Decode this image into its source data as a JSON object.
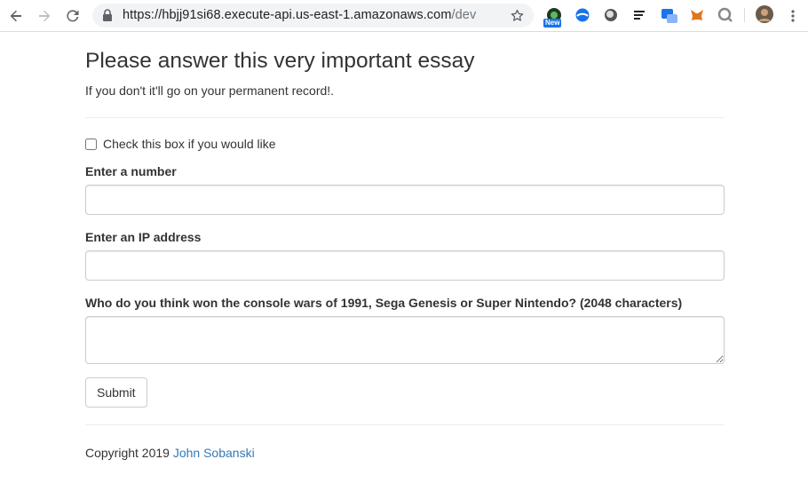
{
  "browser": {
    "url_host": "https://hbjj91si68.execute-api.us-east-1.amazonaws.com",
    "url_path": "/dev",
    "extension_badge": "New",
    "extension_icons": [
      "perfect-tree-icon",
      "ie-tab-icon",
      "circle-extension-icon",
      "notes-extension-icon",
      "translate-extension-icon",
      "metamask-fox-icon",
      "magnifier-extension-icon",
      "profile-avatar"
    ]
  },
  "page": {
    "title": "Please answer this very important essay",
    "lead": "If you don't it'll go on your permanent record!.",
    "checkbox_label": "Check this box if you would like",
    "number_label": "Enter a number",
    "ip_label": "Enter an IP address",
    "essay_label": "Who do you think won the console wars of 1991, Sega Genesis or Super Nintendo? (2048 characters)",
    "number_value": "",
    "ip_value": "",
    "essay_value": "",
    "submit_label": "Submit"
  },
  "footer": {
    "copyright": "Copyright 2019 ",
    "author": "John Sobanski"
  },
  "colors": {
    "link": "#337ab7",
    "text": "#333333",
    "border": "#cccccc"
  }
}
